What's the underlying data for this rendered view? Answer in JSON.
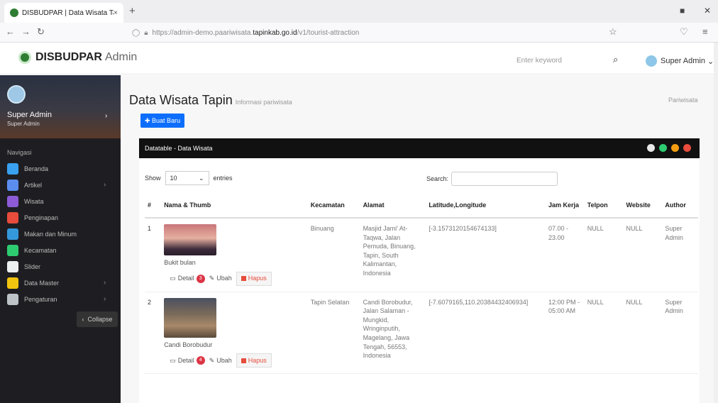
{
  "browser": {
    "tab_title": "DISBUDPAR | Data Wisata Tapin",
    "tab_close": "×",
    "new_tab": "+",
    "url_prefix": "https://admin-demo.paariwisata.",
    "url_domain": "tapinkab.go.id",
    "url_path": "/v1/tourist-attraction"
  },
  "header": {
    "brand_bold": "DISBUDPAR",
    "brand_light": "Admin",
    "search_placeholder": "Enter keyword",
    "user_name": "Super Admin"
  },
  "sidebar": {
    "user_name": "Super Admin",
    "user_role": "Super Admin",
    "nav_label": "Navigasi",
    "items": [
      {
        "label": "Beranda",
        "icon": "monitor-icon",
        "color": "#3aa0f0",
        "arrow": false
      },
      {
        "label": "Artikel",
        "icon": "pencil-icon",
        "color": "#5b8def",
        "arrow": true
      },
      {
        "label": "Wisata",
        "icon": "building-icon",
        "color": "#8e5bd6",
        "arrow": false
      },
      {
        "label": "Penginapan",
        "icon": "hotel-icon",
        "color": "#e74c3c",
        "arrow": false
      },
      {
        "label": "Makan dan Minum",
        "icon": "food-icon",
        "color": "#3498db",
        "arrow": false
      },
      {
        "label": "Kecamatan",
        "icon": "map-icon",
        "color": "#2ecc71",
        "arrow": false
      },
      {
        "label": "Slider",
        "icon": "image-icon",
        "color": "#ecf0f1",
        "arrow": false
      },
      {
        "label": "Data Master",
        "icon": "folder-icon",
        "color": "#f1c40f",
        "arrow": true
      },
      {
        "label": "Pengaturan",
        "icon": "gear-icon",
        "color": "#bdc3c7",
        "arrow": true
      }
    ],
    "collapse_label": "Collapse"
  },
  "main": {
    "title": "Data Wisata Tapin",
    "subtitle": "Informasi pariwisata",
    "breadcrumb": "Pariwisata",
    "create_button": "Buat Baru",
    "panel_title": "Datatable - Data Wisata",
    "show_label": "Show",
    "entries_value": "10",
    "entries_label": "entries",
    "search_label": "Search:",
    "columns": [
      "#",
      "Nama & Thumb",
      "Kecamatan",
      "Alamat",
      "Latitude,Longitude",
      "Jam Kerja",
      "Telpon",
      "Website",
      "Author"
    ],
    "rows": [
      {
        "no": "1",
        "nama": "Bukit bulan",
        "kecamatan": "Binuang",
        "alamat": "Masjid Jami' At-Taqwa, Jalan Pemuda, Binuang, Tapin, South Kalimantan, Indonesia",
        "latlng": "[-3.1573120154674133]",
        "jam": "07.00 - 23.00",
        "telpon": "NULL",
        "website": "NULL",
        "author": "Super Admin",
        "badge": "3"
      },
      {
        "no": "2",
        "nama": "Candi Borobudur",
        "kecamatan": "Tapin Selatan",
        "alamat": "Candi Borobudur, Jalan Salaman - Mungkid, Wringinputih, Magelang, Jawa Tengah, 56553, Indonesia",
        "latlng": "[-7.6079165,110.20384432406934]",
        "jam": "12:00 PM - 05:00 AM",
        "telpon": "NULL",
        "website": "NULL",
        "author": "Super Admin",
        "badge": "4"
      }
    ],
    "action_detail": "Detail",
    "action_edit": "Ubah",
    "action_delete": "Hapus"
  }
}
